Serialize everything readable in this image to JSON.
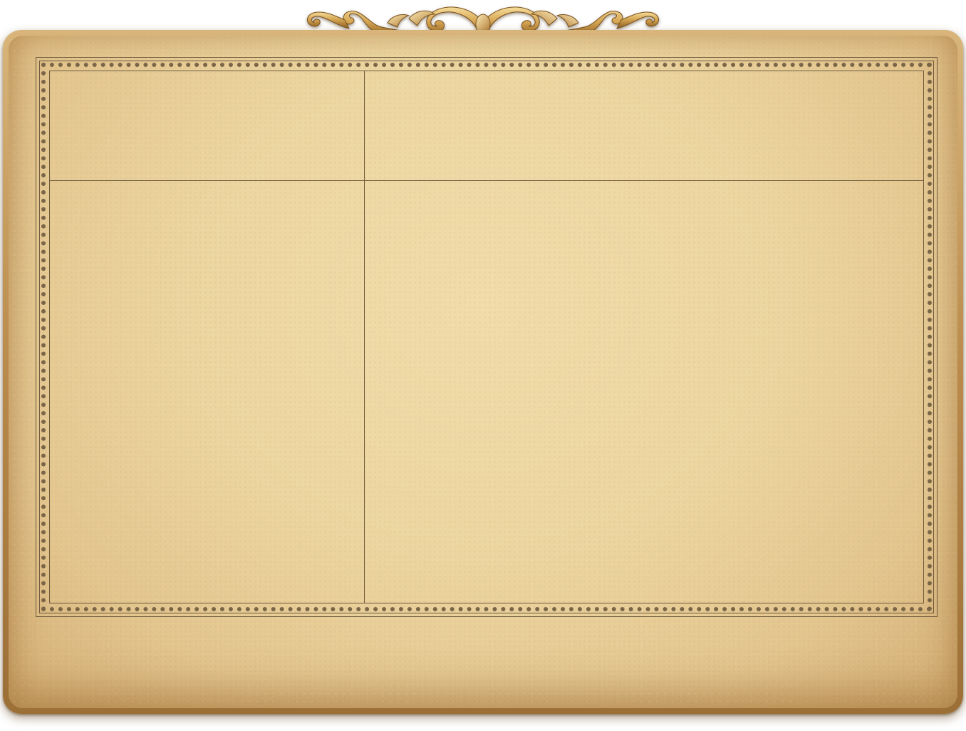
{
  "board": {
    "colors": {
      "parchment": "#ecd5a0",
      "frame_gold": "#b98a4b",
      "line": "#6e5a3d",
      "ornament_gold": "#c99a45"
    },
    "panels": [
      "top-left",
      "top-right",
      "bottom-left",
      "bottom-right"
    ],
    "ornament": "gold-acanthus-scroll-crest-icon"
  }
}
